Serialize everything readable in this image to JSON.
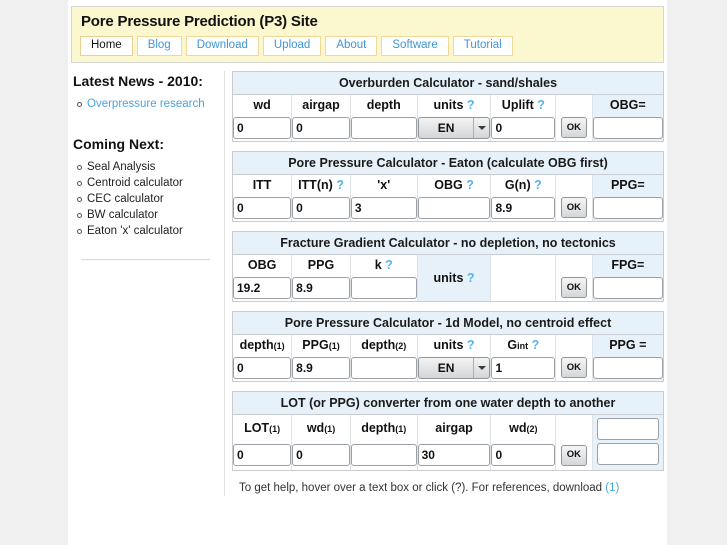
{
  "site": {
    "title": "Pore Pressure Prediction (P3) Site",
    "nav": [
      {
        "label": "Home",
        "active": true
      },
      {
        "label": "Blog",
        "active": false
      },
      {
        "label": "Download",
        "active": false
      },
      {
        "label": "Upload",
        "active": false
      },
      {
        "label": "About",
        "active": false
      },
      {
        "label": "Software",
        "active": false
      },
      {
        "label": "Tutorial",
        "active": false
      }
    ]
  },
  "sidebar": {
    "news_heading": "Latest News - 2010:",
    "news_items": [
      "Overpressure research"
    ],
    "coming_heading": "Coming Next:",
    "coming_items": [
      "Seal Analysis",
      "Centroid calculator",
      "CEC calculator",
      "BW calculator",
      "Eaton 'x' calculator"
    ]
  },
  "help_marker": "?",
  "ok_label": "OK",
  "panels": [
    {
      "title": "Overburden Calculator - sand/shales",
      "fields": [
        {
          "label": "wd",
          "help": false,
          "type": "text",
          "value": "0"
        },
        {
          "label": "airgap",
          "help": false,
          "type": "text",
          "value": "0"
        },
        {
          "label": "depth",
          "help": false,
          "type": "text",
          "value": ""
        },
        {
          "label": "units",
          "help": true,
          "type": "select",
          "value": "EN"
        },
        {
          "label": "Uplift",
          "help": true,
          "type": "text",
          "value": "0"
        },
        {
          "label": "",
          "help": false,
          "type": "ok"
        },
        {
          "label": "OBG=",
          "help": false,
          "type": "result",
          "value": ""
        }
      ]
    },
    {
      "title": "Pore Pressure Calculator - Eaton (calculate OBG first)",
      "fields": [
        {
          "label": "ITT",
          "help": false,
          "type": "text",
          "value": "0"
        },
        {
          "label": "ITT(n)",
          "help": true,
          "type": "text",
          "value": "0"
        },
        {
          "label": "'x'",
          "help": false,
          "type": "text",
          "value": "3"
        },
        {
          "label": "OBG",
          "help": true,
          "type": "text",
          "value": ""
        },
        {
          "label": "G(n)",
          "help": true,
          "type": "text",
          "value": "8.9"
        },
        {
          "label": "",
          "help": false,
          "type": "ok"
        },
        {
          "label": "PPG=",
          "help": false,
          "type": "result",
          "value": ""
        }
      ]
    },
    {
      "title": "Fracture Gradient Calculator - no depletion, no tectonics",
      "fields": [
        {
          "label": "OBG",
          "help": false,
          "type": "text",
          "value": "19.2"
        },
        {
          "label": "PPG",
          "help": false,
          "type": "text",
          "value": "8.9"
        },
        {
          "label": "k",
          "help": true,
          "type": "text",
          "value": ""
        },
        {
          "label": "units",
          "help": true,
          "type": "merged"
        },
        {
          "label": "",
          "help": false,
          "type": "empty"
        },
        {
          "label": "",
          "help": false,
          "type": "ok"
        },
        {
          "label": "FPG=",
          "help": false,
          "type": "result",
          "value": ""
        }
      ]
    },
    {
      "title": "Pore Pressure Calculator - 1d Model, no centroid effect",
      "fields": [
        {
          "label": "depth",
          "sub": "(1)",
          "help": false,
          "type": "text",
          "value": "0"
        },
        {
          "label": "PPG",
          "sub": "(1)",
          "help": false,
          "type": "text",
          "value": "8.9"
        },
        {
          "label": "depth",
          "sub": "(2)",
          "help": false,
          "type": "text",
          "value": ""
        },
        {
          "label": "units",
          "help": true,
          "type": "select",
          "value": "EN"
        },
        {
          "label": "G",
          "sub": "int",
          "help": true,
          "type": "text",
          "value": "1"
        },
        {
          "label": "",
          "help": false,
          "type": "ok"
        },
        {
          "label": "PPG =",
          "help": false,
          "type": "result",
          "value": ""
        }
      ]
    },
    {
      "title": "LOT (or PPG) converter from one water depth to another",
      "fields": [
        {
          "label": "LOT",
          "sub": "(1)",
          "help": false,
          "type": "text",
          "value": "0"
        },
        {
          "label": "wd",
          "sub": "(1)",
          "help": false,
          "type": "text",
          "value": "0"
        },
        {
          "label": "depth",
          "sub": "(1)",
          "help": false,
          "type": "text",
          "value": ""
        },
        {
          "label": "airgap",
          "help": false,
          "type": "text",
          "value": "30"
        },
        {
          "label": "wd",
          "sub": "(2)",
          "help": false,
          "type": "text",
          "value": "0"
        },
        {
          "label": "",
          "help": false,
          "type": "ok"
        },
        {
          "label": "",
          "help": false,
          "type": "dual",
          "value": "",
          "value2": ""
        }
      ]
    }
  ],
  "footer": {
    "text": "To get help, hover over a text box or click (?). For references, download ",
    "link": "(1)"
  },
  "colors": {
    "banner": "#fbf7cf",
    "panel_header": "#e7f1f9",
    "link": "#4aa3df",
    "help": "#59b3e8",
    "page_bg": "#f0f0f0"
  }
}
